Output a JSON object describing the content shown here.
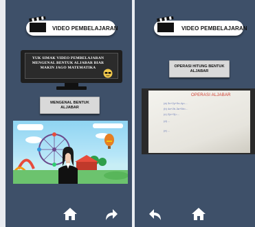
{
  "left_screen": {
    "header_title": "VIDEO PEMBELAJARAN",
    "tv_text": "YUK SIMAK VIDEO PEMBELAJARAN MENGENAL BENTUK ALJABAR BIAR MAKIN JAGO MATEMATIKA",
    "action_button": "MENGENAL BENTUK ALJABAR",
    "video_label_left": "",
    "video_label_right": "",
    "nav": {
      "home_icon": "home-icon",
      "forward_icon": "forward-arrow-icon"
    }
  },
  "right_screen": {
    "header_title": "VIDEO PEMBELAJARAN",
    "action_button": "OPERASI HITUNG BENTUK ALJABAR",
    "paper_title": "OPERASI ALJABAR",
    "paper_lines": [
      "(a) 3x+2y+5x-4y=...",
      "(b) 4a+2b-3a+5b=...",
      "(c) 2(x+3)=...",
      "(d) ...",
      "(e) ..."
    ],
    "nav": {
      "back_icon": "back-arrow-icon",
      "home_icon": "home-icon"
    }
  },
  "colors": {
    "panel_bg": "#3e5069",
    "pill_bg": "#ffffff",
    "button_bg": "#d9d9d9"
  }
}
